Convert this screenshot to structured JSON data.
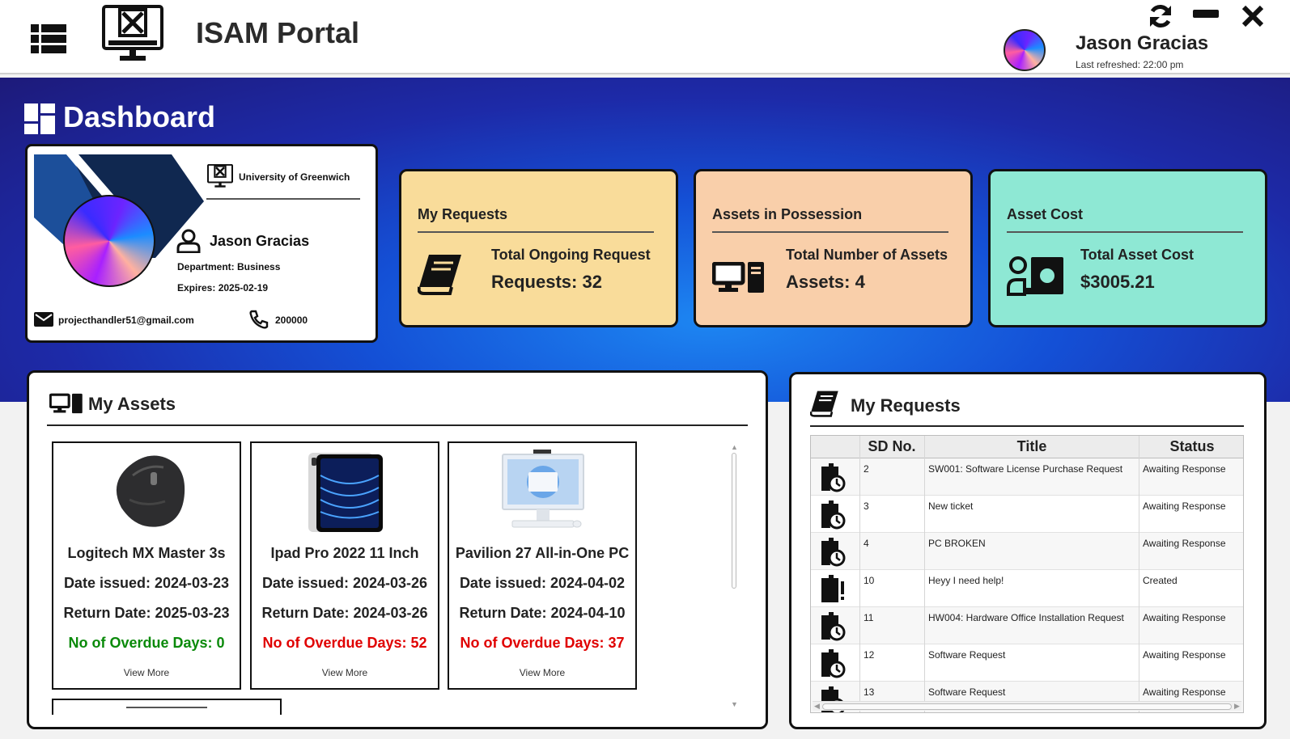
{
  "app": {
    "title": "ISAM Portal",
    "user_name": "Jason Gracias",
    "last_refreshed": "Last refreshed: 22:00 pm"
  },
  "dashboard": {
    "title": "Dashboard"
  },
  "profile": {
    "university": "University of Greenwich",
    "name": "Jason Gracias",
    "department": "Department: Business",
    "expires": "Expires: 2025-02-19",
    "email": "projecthandler51@gmail.com",
    "phone": "200000"
  },
  "stats": [
    {
      "heading": "My Requests",
      "line1": "Total Ongoing Request",
      "line2": "Requests: 32",
      "color": "#f9dc9a"
    },
    {
      "heading": "Assets in Possession",
      "line1": "Total Number of Assets",
      "line2": "Assets: 4",
      "color": "#f9cfaa"
    },
    {
      "heading": "Asset Cost",
      "line1": "Total Asset Cost",
      "line2": "$3005.21",
      "color": "#8ee8d4"
    }
  ],
  "assets_panel": {
    "title": "My Assets",
    "items": [
      {
        "name": "Logitech MX Master 3s",
        "issued": "Date issued: 2024-03-23",
        "return": "Return Date: 2025-03-23",
        "overdue": "No of Overdue Days: 0",
        "overdue_status": "ok",
        "view_more": "View More",
        "icon": "mouse-image"
      },
      {
        "name": "Ipad Pro 2022 11 Inch",
        "issued": "Date issued: 2024-03-26",
        "return": "Return Date: 2024-03-26",
        "overdue": "No of Overdue Days: 52",
        "overdue_status": "bad",
        "view_more": "View More",
        "icon": "tablet-image"
      },
      {
        "name": "Pavilion 27 All-in-One PC",
        "issued": "Date issued: 2024-04-02",
        "return": "Return Date: 2024-04-10",
        "overdue": "No of Overdue Days: 37",
        "overdue_status": "bad",
        "view_more": "View More",
        "icon": "desktop-image"
      }
    ]
  },
  "requests_panel": {
    "title": "My Requests",
    "columns": [
      "SD No.",
      "Title",
      "Status"
    ],
    "rows": [
      {
        "icon": "book-clock-icon",
        "sd": "2",
        "title": "SW001: Software License Purchase Request",
        "status": "Awaiting Response"
      },
      {
        "icon": "book-clock-icon",
        "sd": "3",
        "title": "New ticket",
        "status": "Awaiting Response"
      },
      {
        "icon": "book-clock-icon",
        "sd": "4",
        "title": "PC BROKEN",
        "status": "Awaiting Response"
      },
      {
        "icon": "book-alert-icon",
        "sd": "10",
        "title": "Heyy I need help!",
        "status": "Created"
      },
      {
        "icon": "book-clock-icon",
        "sd": "11",
        "title": "HW004: Hardware Office Installation Request",
        "status": "Awaiting Response"
      },
      {
        "icon": "book-clock-icon",
        "sd": "12",
        "title": "Software Request",
        "status": "Awaiting Response"
      },
      {
        "icon": "book-clock-icon",
        "sd": "13",
        "title": "Software Request",
        "status": "Awaiting Response"
      }
    ]
  }
}
